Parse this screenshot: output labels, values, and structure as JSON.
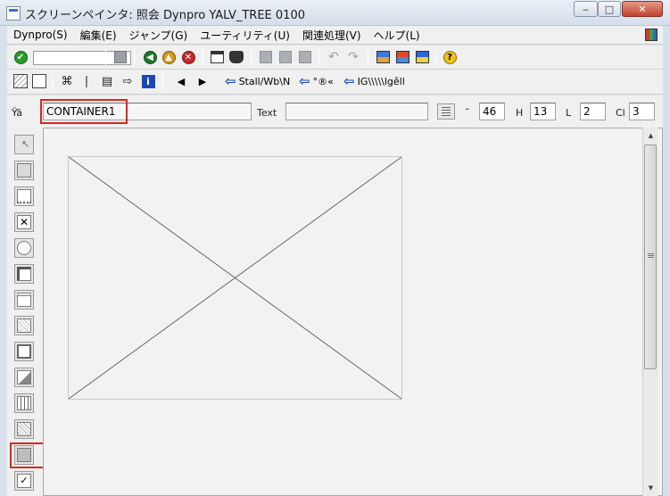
{
  "window": {
    "title": "スクリーンペインタ:   照会 Dynpro YALV_TREE 0100",
    "min_glyph": "‒",
    "max_glyph": "□",
    "close_glyph": "✕"
  },
  "menu": {
    "items": [
      {
        "label": "Dynpro(S)"
      },
      {
        "label": "編集(E)"
      },
      {
        "label": "ジャンプ(G)"
      },
      {
        "label": "ユーティリティ(U)"
      },
      {
        "label": "関連処理(V)"
      },
      {
        "label": "ヘルプ(L)"
      }
    ]
  },
  "toolbar1": {
    "back_glyph": "◀",
    "up_glyph": "▲",
    "cancel_glyph": "✕",
    "help_glyph": "?",
    "check_glyph": "✔"
  },
  "toolbar2": {
    "prev_glyph": "◀",
    "next_glyph": "▶",
    "info_glyph": "i",
    "btn1_label": "Stall/Wb\\N",
    "btn2_label": "°®«",
    "btn3_label": "IG\\\\\\\\\\lgêll"
  },
  "attributes": {
    "name_label": "Ÿä",
    "name_value": "CONTAINER1",
    "text_label": "Text",
    "text_value": "",
    "line_label": "˜",
    "line_value": "46",
    "height_label": "H",
    "height_value": "13",
    "length_label": "L",
    "length_value": "2",
    "column_label": "Cl",
    "column_value": "3"
  },
  "scrollbar": {
    "up_glyph": "▲",
    "down_glyph": "▼"
  }
}
